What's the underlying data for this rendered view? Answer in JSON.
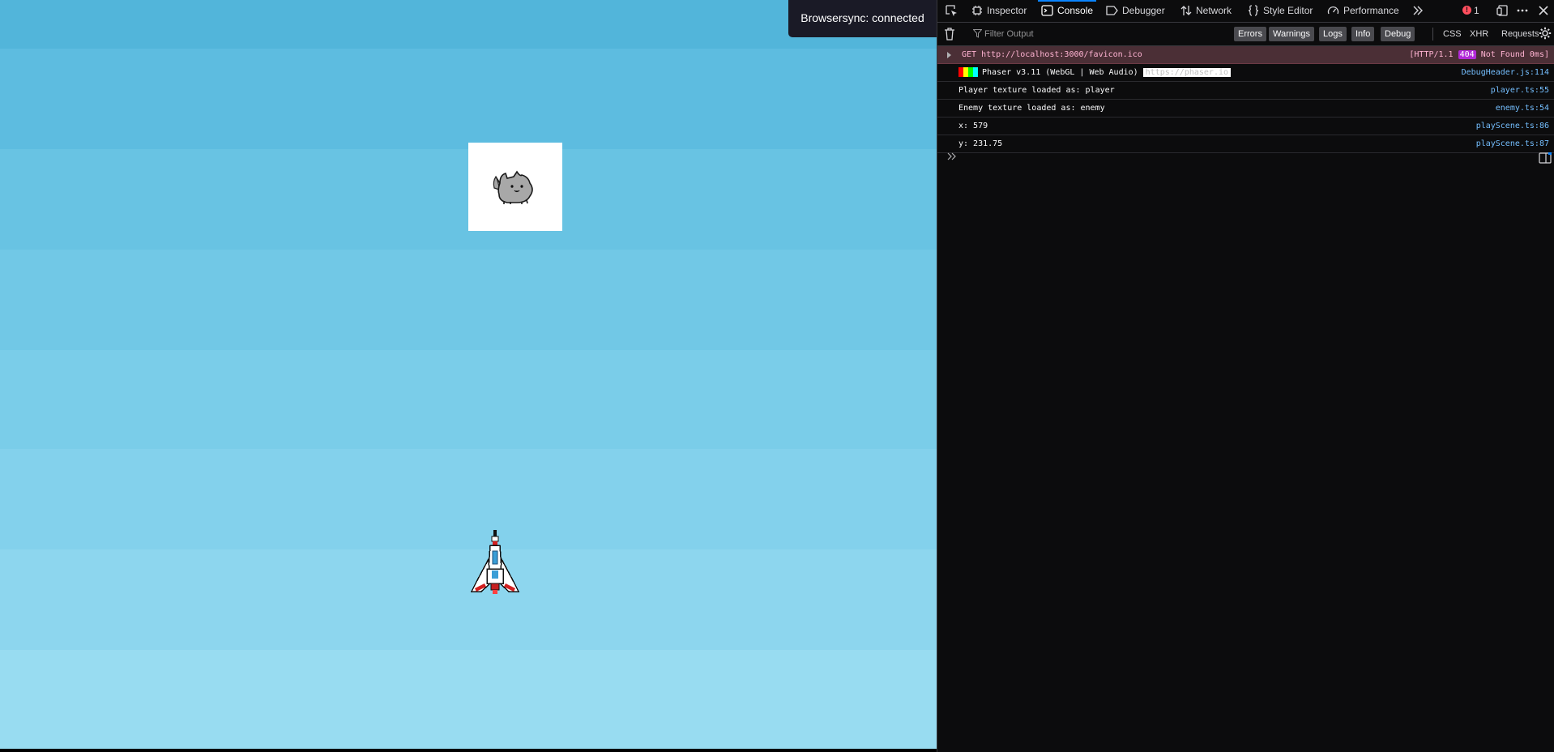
{
  "game": {
    "sky_bands": [
      "#52b5da",
      "#5dbce0",
      "#68c3e3",
      "#71c8e6",
      "#7acde9",
      "#83d1ec",
      "#8dd6ee",
      "#98dcf1"
    ],
    "bottom_strip_color": "#000000",
    "enemy_box_color": "#ffffff",
    "enemy_icon": "cat-enemy-sprite",
    "player_icon": "spaceship-player-sprite"
  },
  "browsersync": {
    "message": "Browsersync: connected"
  },
  "devtools": {
    "toolbar": {
      "inspector_label": "Inspector",
      "console_label": "Console",
      "debugger_label": "Debugger",
      "network_label": "Network",
      "style_editor_label": "Style Editor",
      "performance_label": "Performance",
      "error_count": "1"
    },
    "filter": {
      "placeholder": "Filter Output",
      "buttons": {
        "errors": "Errors",
        "warnings": "Warnings",
        "logs": "Logs",
        "info": "Info",
        "debug": "Debug",
        "css": "CSS",
        "xhr": "XHR",
        "requests": "Requests"
      }
    },
    "messages": {
      "favicon_error": {
        "text": "GET http://localhost:3000/favicon.ico",
        "status_pre": "[HTTP/1.1",
        "status_code": "404",
        "status_post": "Not Found 0ms]"
      },
      "phaser": {
        "text": "Phaser v3.11 (WebGL | Web Audio)",
        "link": "https://phaser.io",
        "src": "DebugHeader.js:114",
        "colors": [
          "#ff0000",
          "#ffff00",
          "#00ff00",
          "#00ffff"
        ]
      },
      "player": {
        "text": "Player texture loaded as: player",
        "src": "player.ts:55"
      },
      "enemy": {
        "text": "Enemy texture loaded as: enemy",
        "src": "enemy.ts:54"
      },
      "x": {
        "text": "x: 579",
        "src": "playScene.ts:86"
      },
      "y": {
        "text": "y: 231.75",
        "src": "playScene.ts:87"
      }
    },
    "colors": {
      "accent": "#0a84ff",
      "error_bg": "#4b2f36",
      "link": "#75bfff"
    }
  }
}
